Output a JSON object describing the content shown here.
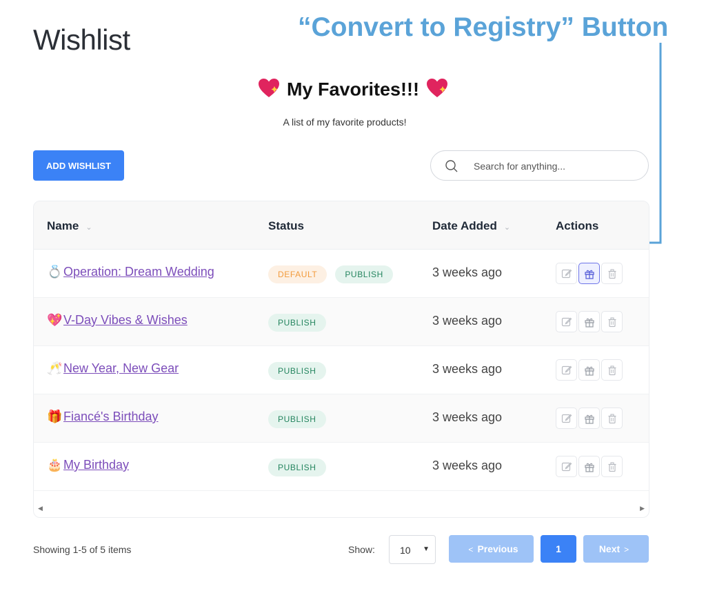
{
  "page": {
    "title": "Wishlist"
  },
  "annotation": {
    "text": "“Convert to Registry” Button",
    "color": "#5aa3d8"
  },
  "wishlist": {
    "title": "My Favorites!!!",
    "subtitle": "A list of my favorite products!"
  },
  "toolbar": {
    "add_label": "ADD WISHLIST",
    "search_placeholder": "Search for anything..."
  },
  "table": {
    "columns": {
      "name": "Name",
      "status": "Status",
      "date": "Date Added",
      "actions": "Actions"
    },
    "rows": [
      {
        "emoji": "💍",
        "name": "Operation: Dream Wedding",
        "statuses": [
          "DEFAULT",
          "PUBLISH"
        ],
        "date": "3 weeks ago"
      },
      {
        "emoji": "💖",
        "name": "V-Day Vibes & Wishes",
        "statuses": [
          "PUBLISH"
        ],
        "date": "3 weeks ago"
      },
      {
        "emoji": "🥂",
        "name": "New Year, New Gear",
        "statuses": [
          "PUBLISH"
        ],
        "date": "3 weeks ago"
      },
      {
        "emoji": "🎁",
        "name": "Fiancé's Birthday",
        "statuses": [
          "PUBLISH"
        ],
        "date": "3 weeks ago"
      },
      {
        "emoji": "🎂",
        "name": "My Birthday",
        "statuses": [
          "PUBLISH"
        ],
        "date": "3 weeks ago"
      }
    ],
    "action_icons": [
      "edit-icon",
      "gift-icon",
      "trash-icon"
    ]
  },
  "footer": {
    "showing": "Showing 1-5 of 5 items",
    "show_label": "Show:",
    "page_size": "10",
    "prev_label": "Previous",
    "current_page": "1",
    "next_label": "Next"
  },
  "colors": {
    "primary": "#3b82f6",
    "link": "#7c4dba",
    "default_badge": "#f29b3c",
    "publish_badge": "#25855f",
    "highlight": "#6d74e8"
  }
}
